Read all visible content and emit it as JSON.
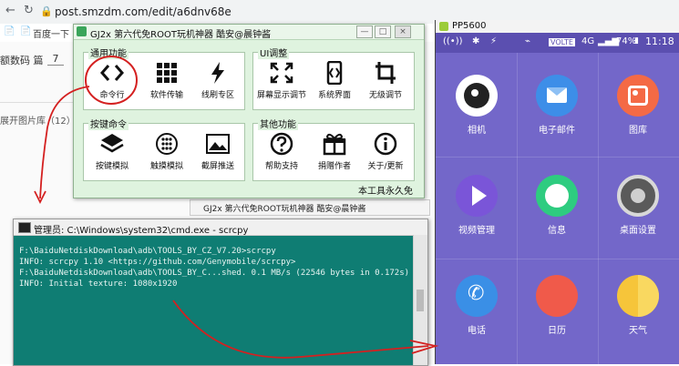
{
  "browser": {
    "url": "post.smzdm.com/edit/a6dnv68e",
    "bookmarks": [
      "百度一下"
    ],
    "editor_row1": "额数码 篇",
    "editor_count": "7",
    "editor_row2": "展开图片库（12）"
  },
  "gj_window": {
    "title": "GJ2x 第六代免ROOT玩机神器  酷安@晨钟酱",
    "footer": "本工具永久免",
    "groups": {
      "general": {
        "label": "通用功能",
        "tools": [
          "命令行",
          "软件传输",
          "线刷专区"
        ]
      },
      "ui": {
        "label": "UI调整",
        "tools": [
          "屏幕显示调节",
          "系统界面",
          "无级调节"
        ]
      },
      "keys": {
        "label": "按键命令",
        "tools": [
          "按键模拟",
          "触摸模拟",
          "截屏推送"
        ]
      },
      "other": {
        "label": "其他功能",
        "tools": [
          "帮助支持",
          "捐赠作者",
          "关于/更新"
        ]
      }
    },
    "behind_title": "GJ2x 第六代免ROOT玩机神器  酷安@晨钟酱"
  },
  "cmd_window": {
    "title": "管理员: C:\\Windows\\system32\\cmd.exe - scrcpy",
    "lines": [
      "F:\\BaiduNetdiskDownload\\adb\\TOOLS_BY_CZ_V7.20>scrcpy",
      "INFO: scrcpy 1.10 <https://github.com/Genymobile/scrcpy>",
      "F:\\BaiduNetdiskDownload\\adb\\TOOLS_BY_C...shed. 0.1 MB/s (22546 bytes in 0.172s)",
      "INFO: Initial texture: 1080x1920"
    ]
  },
  "phone": {
    "window_title": "PP5600",
    "status": {
      "network": "VOLTE",
      "signal": "4G",
      "battery": "74%",
      "time": "11:18"
    },
    "apps": [
      {
        "label": "相机",
        "color": "#ffffff",
        "icon": "camera-icon"
      },
      {
        "label": "电子邮件",
        "color": "#3d8ee8",
        "icon": "mail-icon"
      },
      {
        "label": "图库",
        "color": "#f46a45",
        "icon": "gallery-icon"
      },
      {
        "label": "视频管理",
        "color": "#7a55d8",
        "icon": "play-icon"
      },
      {
        "label": "信息",
        "color": "#2ecc80",
        "icon": "message-icon"
      },
      {
        "label": "桌面设置",
        "color": "#666666",
        "icon": "gear-icon"
      },
      {
        "label": "电话",
        "color": "#3a8fe6",
        "icon": "phone-icon"
      },
      {
        "label": "日历",
        "color": "#f05a4a",
        "icon": "calendar-icon"
      },
      {
        "label": "天气",
        "color": "#f6c53a",
        "icon": "weather-icon"
      }
    ]
  },
  "annotation_color": "#d42020"
}
